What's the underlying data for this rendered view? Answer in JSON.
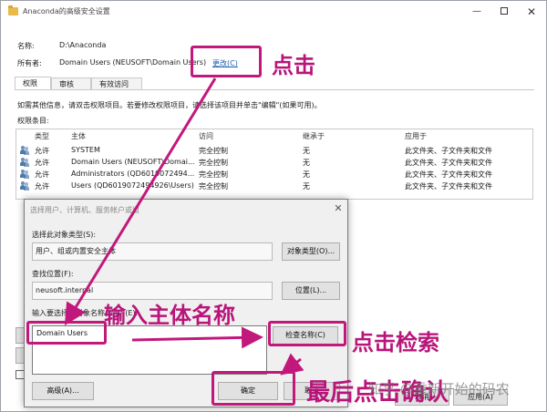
{
  "window": {
    "title": "Anaconda的高级安全设置",
    "min": "—",
    "close": "✕"
  },
  "header": {
    "name_label": "名称:",
    "name_value": "D:\\Anaconda",
    "owner_label": "所有者:",
    "owner_value": "Domain Users (NEUSOFT\\Domain Users)",
    "change_link": "更改(C)"
  },
  "tabs": [
    {
      "label": "权限"
    },
    {
      "label": "审核"
    },
    {
      "label": "有效访问"
    }
  ],
  "info_text": "如需其他信息，请双击权限项目。若要修改权限项目，请选择该项目并单击\"编辑\"(如果可用)。",
  "entries_label": "权限条目:",
  "perm_table": {
    "headers": [
      "类型",
      "主体",
      "访问",
      "继承于",
      "应用于"
    ],
    "rows": [
      [
        "允许",
        "SYSTEM",
        "完全控制",
        "无",
        "此文件夹、子文件夹和文件"
      ],
      [
        "允许",
        "Domain Users (NEUSOFT\\Domai...",
        "完全控制",
        "无",
        "此文件夹、子文件夹和文件"
      ],
      [
        "允许",
        "Administrators (QD6019072494...",
        "完全控制",
        "无",
        "此文件夹、子文件夹和文件"
      ],
      [
        "允许",
        "Users (QD6019072494926\\Users)",
        "完全控制",
        "无",
        "此文件夹、子文件夹和文件"
      ]
    ]
  },
  "back_buttons": {
    "cancel": "取消",
    "apply": "应用(A)"
  },
  "dialog": {
    "title": "选择用户、计算机、服务帐户或组",
    "close": "✕",
    "object_type_label": "选择此对象类型(S):",
    "object_type_value": "用户、组或内置安全主体",
    "object_type_button": "对象类型(O)...",
    "location_label": "查找位置(F):",
    "location_value": "neusoft.internal",
    "location_button": "位置(L)...",
    "names_label": "输入要选择的对象名称(例如)(E):",
    "names_value": "Domain Users",
    "check_names_button": "检查名称(C)",
    "advanced_button": "高级(A)...",
    "ok_button": "确定",
    "cancel_button": "取消"
  },
  "annotations": {
    "click": "点击",
    "enter_name": "输入主体名称",
    "click_check": "点击检索",
    "final_ok": "最后点击确认"
  },
  "watermark": "知乎 @重新开始的码农",
  "colors": {
    "annotation": "#b8157a",
    "link": "#1a5fb4"
  }
}
